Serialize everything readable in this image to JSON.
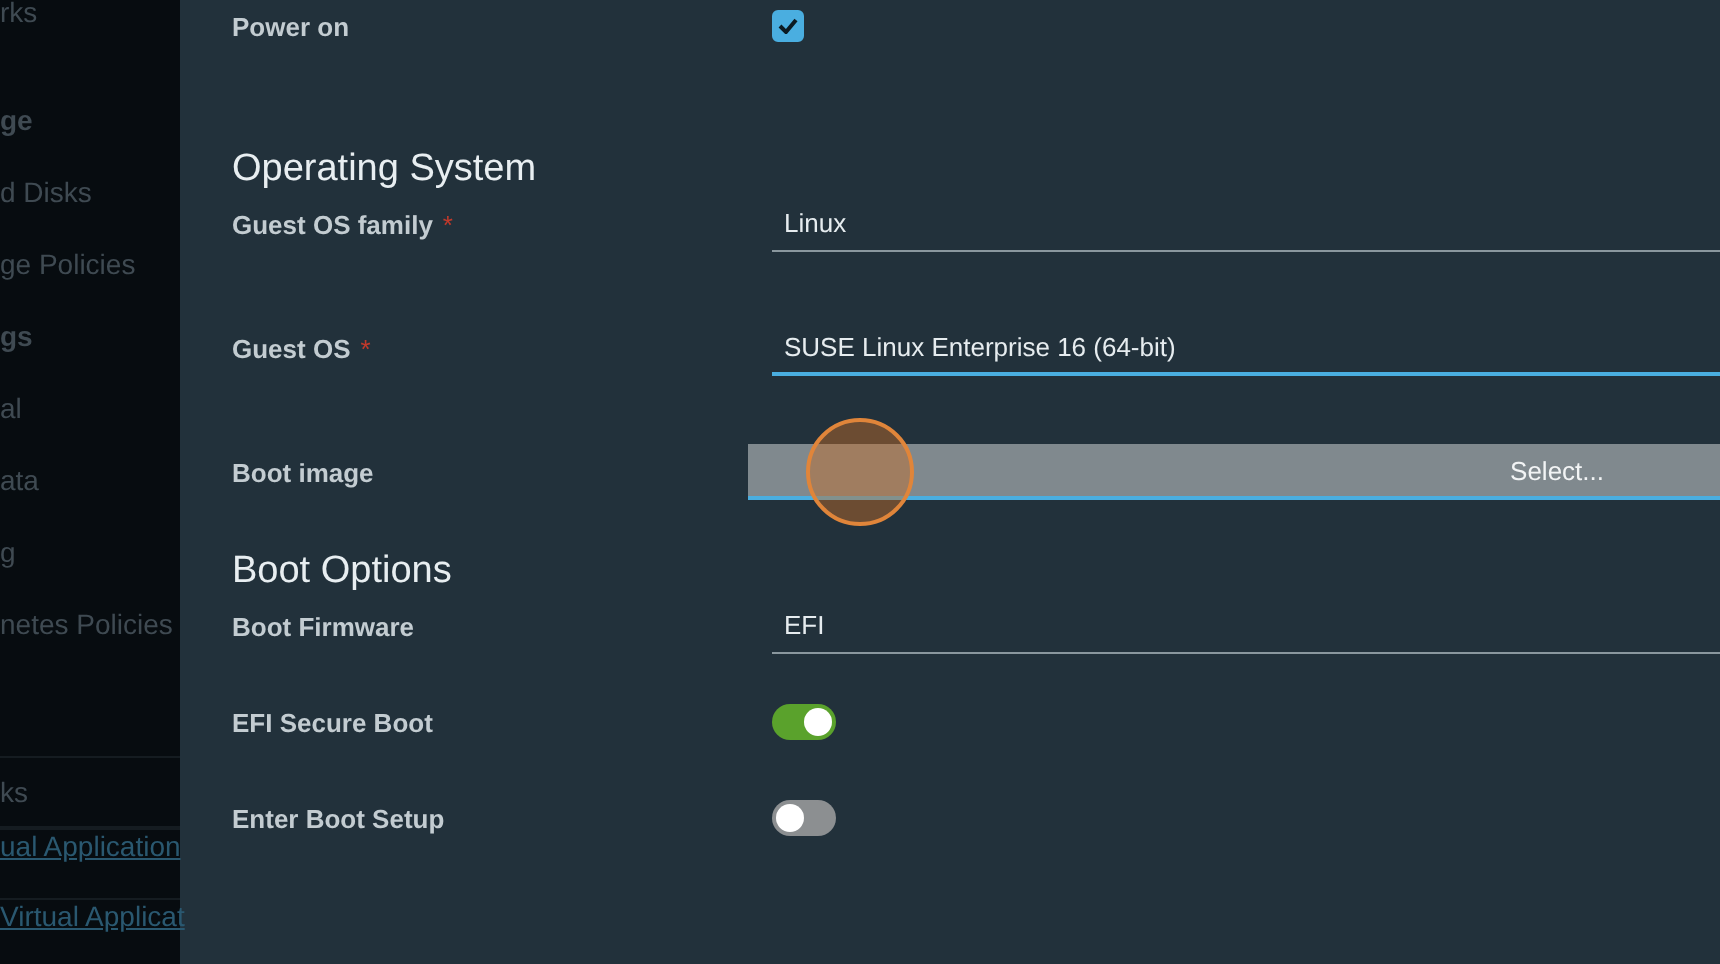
{
  "sidebar": {
    "items": [
      {
        "kind": "item",
        "text": "rks"
      },
      {
        "kind": "header",
        "text": "ge"
      },
      {
        "kind": "item",
        "text": "d Disks"
      },
      {
        "kind": "item",
        "text": "ge Policies"
      },
      {
        "kind": "header",
        "text": "gs"
      },
      {
        "kind": "item",
        "text": "al"
      },
      {
        "kind": "item",
        "text": "ata"
      },
      {
        "kind": "item",
        "text": "g"
      },
      {
        "kind": "item",
        "text": "netes Policies"
      },
      {
        "kind": "separator-item",
        "text": "ks"
      },
      {
        "kind": "spacer"
      },
      {
        "kind": "link",
        "text": "ual Application"
      },
      {
        "kind": "link",
        "text": "Virtual Applicat"
      }
    ]
  },
  "sections": [
    {
      "fields": [
        {
          "kind": "checkbox",
          "label": "Power on",
          "checked": true
        }
      ]
    },
    {
      "title": "Operating System",
      "fields": [
        {
          "kind": "select",
          "label": "Guest OS family",
          "required_mark": "*",
          "value": "Linux",
          "focused": false
        },
        {
          "kind": "select",
          "label": "Guest OS",
          "required_mark": "*",
          "value": "SUSE Linux Enterprise 16 (64-bit)",
          "focused": true
        },
        {
          "kind": "file",
          "label": "Boot image",
          "button": "Select...",
          "focused": true
        }
      ]
    },
    {
      "title": "Boot Options",
      "fields": [
        {
          "kind": "select",
          "label": "Boot Firmware",
          "value": "EFI",
          "focused": false
        },
        {
          "kind": "toggle",
          "label": "EFI Secure Boot",
          "on": true
        },
        {
          "kind": "toggle",
          "label": "Enter Boot Setup",
          "on": false
        }
      ]
    }
  ]
}
